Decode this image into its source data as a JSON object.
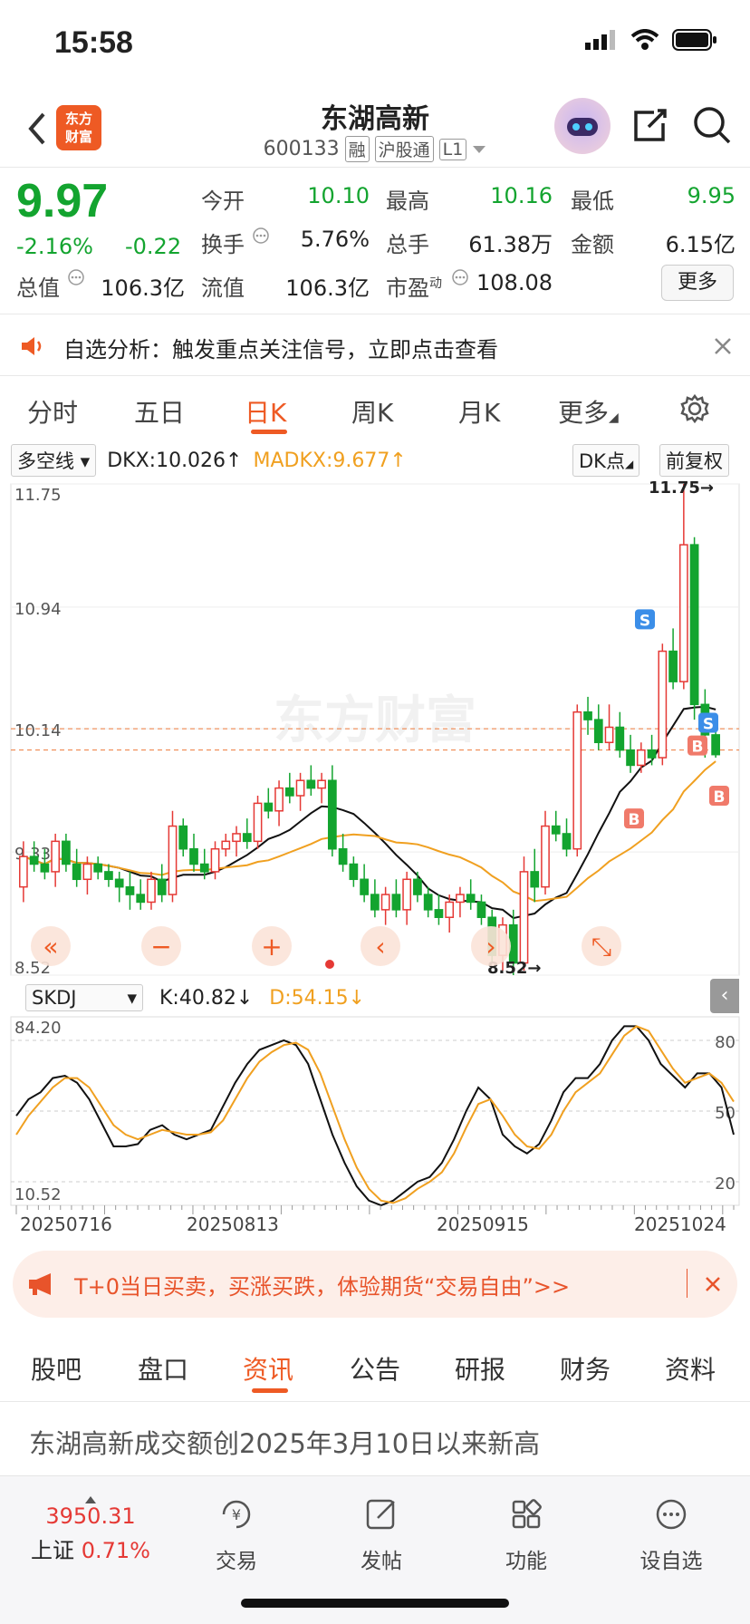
{
  "status_bar": {
    "time": "15:58"
  },
  "header": {
    "logo_text_1": "东方",
    "logo_text_2": "财富",
    "title": "东湖高新",
    "code": "600133",
    "tags": [
      "融",
      "沪股通",
      "L1"
    ]
  },
  "quote": {
    "price": "9.97",
    "change_pct": "-2.16%",
    "change": "-0.22",
    "fields": [
      {
        "label": "今开",
        "value": "10.10",
        "color": "#13a42f"
      },
      {
        "label": "最高",
        "value": "10.16",
        "color": "#13a42f"
      },
      {
        "label": "最低",
        "value": "9.95",
        "color": "#13a42f"
      },
      {
        "label": "换手",
        "value": "5.76%",
        "color": "#222222"
      },
      {
        "label": "总手",
        "value": "61.38万",
        "color": "#222222"
      },
      {
        "label": "金额",
        "value": "6.15亿",
        "color": "#222222"
      },
      {
        "label": "总值",
        "value": "106.3亿",
        "color": "#222222"
      },
      {
        "label": "流值",
        "value": "106.3亿",
        "color": "#222222"
      },
      {
        "label": "市盈",
        "value": "108.08",
        "color": "#222222"
      }
    ],
    "pe_sup": "动",
    "more_label": "更多"
  },
  "alert": {
    "text": "自选分析：触发重点关注信号，立即点击查看"
  },
  "kline_tabs": [
    "分时",
    "五日",
    "日K",
    "周K",
    "月K",
    "更多"
  ],
  "active_tab": "日K",
  "indicators": {
    "main_select": "多空线",
    "dkx": "DKX:10.026↑",
    "madkx": "MADKX:9.677↑",
    "dk_point": "DK点",
    "adjust": "前复权",
    "sub_select": "SKDJ",
    "k": "K:40.82↓",
    "d": "D:54.15↓"
  },
  "watermark": "东方财富",
  "chart_data": [
    {
      "type": "candlestick",
      "y_ticks": [
        "11.75",
        "10.94",
        "10.14",
        "9.33",
        "8.52"
      ],
      "ylim": [
        8.52,
        11.75
      ],
      "max_label": "11.75→",
      "min_label": "8.52→",
      "signals": [
        "S",
        "S",
        "B",
        "B",
        "B"
      ],
      "candles": [
        [
          9.1,
          9.4,
          9.0,
          9.3
        ],
        [
          9.3,
          9.4,
          9.2,
          9.25
        ],
        [
          9.25,
          9.35,
          9.15,
          9.2
        ],
        [
          9.2,
          9.45,
          9.1,
          9.4
        ],
        [
          9.4,
          9.45,
          9.2,
          9.25
        ],
        [
          9.25,
          9.35,
          9.1,
          9.15
        ],
        [
          9.15,
          9.3,
          9.05,
          9.25
        ],
        [
          9.25,
          9.3,
          9.15,
          9.2
        ],
        [
          9.2,
          9.25,
          9.1,
          9.15
        ],
        [
          9.15,
          9.2,
          9.0,
          9.1
        ],
        [
          9.1,
          9.2,
          8.95,
          9.05
        ],
        [
          9.05,
          9.15,
          8.95,
          9.0
        ],
        [
          9.0,
          9.2,
          8.95,
          9.15
        ],
        [
          9.15,
          9.25,
          9.0,
          9.05
        ],
        [
          9.05,
          9.6,
          9.0,
          9.5
        ],
        [
          9.5,
          9.55,
          9.3,
          9.35
        ],
        [
          9.35,
          9.45,
          9.2,
          9.25
        ],
        [
          9.25,
          9.35,
          9.15,
          9.2
        ],
        [
          9.2,
          9.4,
          9.15,
          9.35
        ],
        [
          9.35,
          9.45,
          9.3,
          9.4
        ],
        [
          9.4,
          9.5,
          9.3,
          9.45
        ],
        [
          9.45,
          9.55,
          9.35,
          9.4
        ],
        [
          9.4,
          9.7,
          9.35,
          9.65
        ],
        [
          9.65,
          9.75,
          9.55,
          9.6
        ],
        [
          9.6,
          9.8,
          9.5,
          9.75
        ],
        [
          9.75,
          9.85,
          9.65,
          9.7
        ],
        [
          9.7,
          9.85,
          9.6,
          9.8
        ],
        [
          9.8,
          9.9,
          9.7,
          9.75
        ],
        [
          9.75,
          9.85,
          9.65,
          9.8
        ],
        [
          9.8,
          9.9,
          9.3,
          9.35
        ],
        [
          9.35,
          9.45,
          9.2,
          9.25
        ],
        [
          9.25,
          9.3,
          9.1,
          9.15
        ],
        [
          9.15,
          9.25,
          9.0,
          9.05
        ],
        [
          9.05,
          9.15,
          8.9,
          8.95
        ],
        [
          8.95,
          9.1,
          8.85,
          9.05
        ],
        [
          9.05,
          9.15,
          8.9,
          8.95
        ],
        [
          8.95,
          9.2,
          8.85,
          9.15
        ],
        [
          9.15,
          9.2,
          9.0,
          9.05
        ],
        [
          9.05,
          9.1,
          8.9,
          8.95
        ],
        [
          8.95,
          9.05,
          8.85,
          8.9
        ],
        [
          8.9,
          9.05,
          8.8,
          9.0
        ],
        [
          9.0,
          9.1,
          8.9,
          9.05
        ],
        [
          9.05,
          9.15,
          8.95,
          9.0
        ],
        [
          9.0,
          9.05,
          8.85,
          8.9
        ],
        [
          8.9,
          8.95,
          8.6,
          8.65
        ],
        [
          8.65,
          8.9,
          8.55,
          8.85
        ],
        [
          8.85,
          8.95,
          8.52,
          8.6
        ],
        [
          8.6,
          9.3,
          8.55,
          9.2
        ],
        [
          9.2,
          9.35,
          9.0,
          9.1
        ],
        [
          9.1,
          9.6,
          9.05,
          9.5
        ],
        [
          9.5,
          9.6,
          9.4,
          9.45
        ],
        [
          9.45,
          9.55,
          9.3,
          9.35
        ],
        [
          9.35,
          10.3,
          9.3,
          10.25
        ],
        [
          10.25,
          10.35,
          10.1,
          10.2
        ],
        [
          10.2,
          10.3,
          10.0,
          10.05
        ],
        [
          10.05,
          10.3,
          10.0,
          10.15
        ],
        [
          10.15,
          10.25,
          9.95,
          10.0
        ],
        [
          10.0,
          10.1,
          9.85,
          9.9
        ],
        [
          9.9,
          10.05,
          9.85,
          10.0
        ],
        [
          10.0,
          10.1,
          9.9,
          9.95
        ],
        [
          9.95,
          10.7,
          9.9,
          10.65
        ],
        [
          10.65,
          10.8,
          10.4,
          10.45
        ],
        [
          10.45,
          11.75,
          10.4,
          11.35
        ],
        [
          11.35,
          11.4,
          10.2,
          10.3
        ],
        [
          10.3,
          10.4,
          9.95,
          10.1
        ],
        [
          10.1,
          10.2,
          9.95,
          9.97
        ]
      ]
    },
    {
      "type": "line",
      "title": "SKDJ",
      "y_ticks_left": [
        "84.20",
        "10.52"
      ],
      "y_ticks_right": [
        "80",
        "50",
        "20"
      ],
      "x_ticks": [
        "20250716",
        "20250813",
        "20250915",
        "20251024"
      ],
      "series": [
        {
          "name": "K",
          "color": "#111111",
          "values": [
            48,
            55,
            58,
            64,
            65,
            62,
            55,
            45,
            35,
            35,
            36,
            42,
            44,
            40,
            38,
            40,
            42,
            52,
            62,
            70,
            76,
            78,
            80,
            78,
            70,
            55,
            40,
            28,
            18,
            12,
            10,
            12,
            16,
            20,
            22,
            28,
            38,
            50,
            60,
            55,
            40,
            35,
            32,
            36,
            46,
            58,
            64,
            64,
            70,
            80,
            86,
            86,
            80,
            70,
            65,
            60,
            66,
            66,
            60,
            40
          ]
        },
        {
          "name": "D",
          "color": "#f0a020",
          "values": [
            40,
            48,
            54,
            60,
            64,
            64,
            60,
            52,
            44,
            40,
            38,
            40,
            42,
            41,
            40,
            40,
            41,
            46,
            55,
            64,
            71,
            75,
            78,
            79,
            76,
            66,
            52,
            38,
            26,
            17,
            12,
            11,
            13,
            17,
            20,
            24,
            32,
            43,
            53,
            55,
            48,
            40,
            35,
            34,
            40,
            50,
            58,
            62,
            66,
            74,
            82,
            86,
            84,
            76,
            68,
            62,
            64,
            66,
            62,
            54
          ]
        }
      ]
    }
  ],
  "promo": {
    "text": "T+0当日买卖，买涨买跌，体验期货“交易自由”>>"
  },
  "bottom_tabs": [
    "股吧",
    "盘口",
    "资讯",
    "公告",
    "研报",
    "财务",
    "资料"
  ],
  "bottom_active": "资讯",
  "news": {
    "headline": "东湖高新成交额创2025年3月10日以来新高"
  },
  "footer": {
    "index_value": "3950.31",
    "index_name": "上证",
    "index_pct": "0.71%",
    "items": [
      "交易",
      "发帖",
      "功能",
      "设自选"
    ]
  }
}
